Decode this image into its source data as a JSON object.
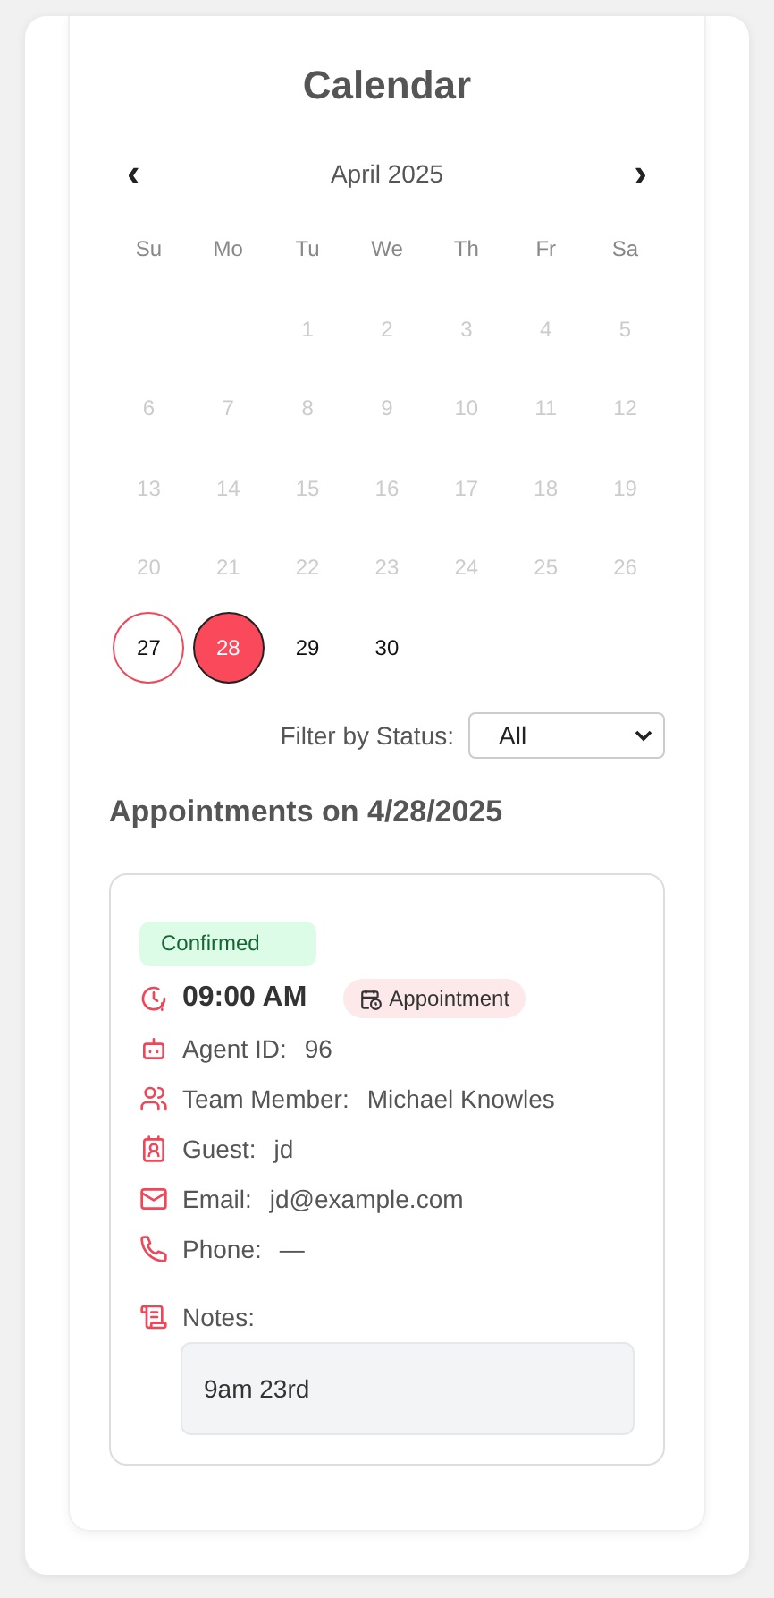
{
  "title": "Calendar",
  "calendar": {
    "prev": "‹",
    "month": "April 2025",
    "next": "›",
    "weekdays": [
      "Su",
      "Mo",
      "Tu",
      "We",
      "Th",
      "Fr",
      "Sa"
    ],
    "days": [
      {
        "kind": "empty"
      },
      {
        "kind": "empty"
      },
      {
        "kind": "day",
        "label": "1",
        "disabled": true,
        "today": false,
        "selected": false
      },
      {
        "kind": "day",
        "label": "2",
        "disabled": true,
        "today": false,
        "selected": false
      },
      {
        "kind": "day",
        "label": "3",
        "disabled": true,
        "today": false,
        "selected": false
      },
      {
        "kind": "day",
        "label": "4",
        "disabled": true,
        "today": false,
        "selected": false
      },
      {
        "kind": "day",
        "label": "5",
        "disabled": true,
        "today": false,
        "selected": false
      },
      {
        "kind": "day",
        "label": "6",
        "disabled": true,
        "today": false,
        "selected": false
      },
      {
        "kind": "day",
        "label": "7",
        "disabled": true,
        "today": false,
        "selected": false
      },
      {
        "kind": "day",
        "label": "8",
        "disabled": true,
        "today": false,
        "selected": false
      },
      {
        "kind": "day",
        "label": "9",
        "disabled": true,
        "today": false,
        "selected": false
      },
      {
        "kind": "day",
        "label": "10",
        "disabled": true,
        "today": false,
        "selected": false
      },
      {
        "kind": "day",
        "label": "11",
        "disabled": true,
        "today": false,
        "selected": false
      },
      {
        "kind": "day",
        "label": "12",
        "disabled": true,
        "today": false,
        "selected": false
      },
      {
        "kind": "day",
        "label": "13",
        "disabled": true,
        "today": false,
        "selected": false
      },
      {
        "kind": "day",
        "label": "14",
        "disabled": true,
        "today": false,
        "selected": false
      },
      {
        "kind": "day",
        "label": "15",
        "disabled": true,
        "today": false,
        "selected": false
      },
      {
        "kind": "day",
        "label": "16",
        "disabled": true,
        "today": false,
        "selected": false
      },
      {
        "kind": "day",
        "label": "17",
        "disabled": true,
        "today": false,
        "selected": false
      },
      {
        "kind": "day",
        "label": "18",
        "disabled": true,
        "today": false,
        "selected": false
      },
      {
        "kind": "day",
        "label": "19",
        "disabled": true,
        "today": false,
        "selected": false
      },
      {
        "kind": "day",
        "label": "20",
        "disabled": true,
        "today": false,
        "selected": false
      },
      {
        "kind": "day",
        "label": "21",
        "disabled": true,
        "today": false,
        "selected": false
      },
      {
        "kind": "day",
        "label": "22",
        "disabled": true,
        "today": false,
        "selected": false
      },
      {
        "kind": "day",
        "label": "23",
        "disabled": true,
        "today": false,
        "selected": false
      },
      {
        "kind": "day",
        "label": "24",
        "disabled": true,
        "today": false,
        "selected": false
      },
      {
        "kind": "day",
        "label": "25",
        "disabled": true,
        "today": false,
        "selected": false
      },
      {
        "kind": "day",
        "label": "26",
        "disabled": true,
        "today": false,
        "selected": false
      },
      {
        "kind": "day",
        "label": "27",
        "disabled": false,
        "today": true,
        "selected": false
      },
      {
        "kind": "day",
        "label": "28",
        "disabled": false,
        "today": false,
        "selected": true
      },
      {
        "kind": "day",
        "label": "29",
        "disabled": false,
        "today": false,
        "selected": false
      },
      {
        "kind": "day",
        "label": "30",
        "disabled": false,
        "today": false,
        "selected": false
      }
    ]
  },
  "filter": {
    "label": "Filter by Status:",
    "value": "All"
  },
  "appointments_heading": "Appointments on 4/28/2025",
  "appointment": {
    "status": "Confirmed",
    "time": "09:00 AM",
    "type": "Appointment",
    "details": [
      {
        "kind": "agent",
        "label": "Agent ID:",
        "value": "96"
      },
      {
        "kind": "team",
        "label": "Team Member:",
        "value": "Michael Knowles"
      },
      {
        "kind": "guest",
        "label": "Guest:",
        "value": "jd"
      },
      {
        "kind": "email",
        "label": "Email:",
        "value": "jd@example.com"
      },
      {
        "kind": "phone",
        "label": "Phone:",
        "value": "—"
      }
    ],
    "notes_label": "Notes:",
    "notes": "9am 23rd"
  }
}
